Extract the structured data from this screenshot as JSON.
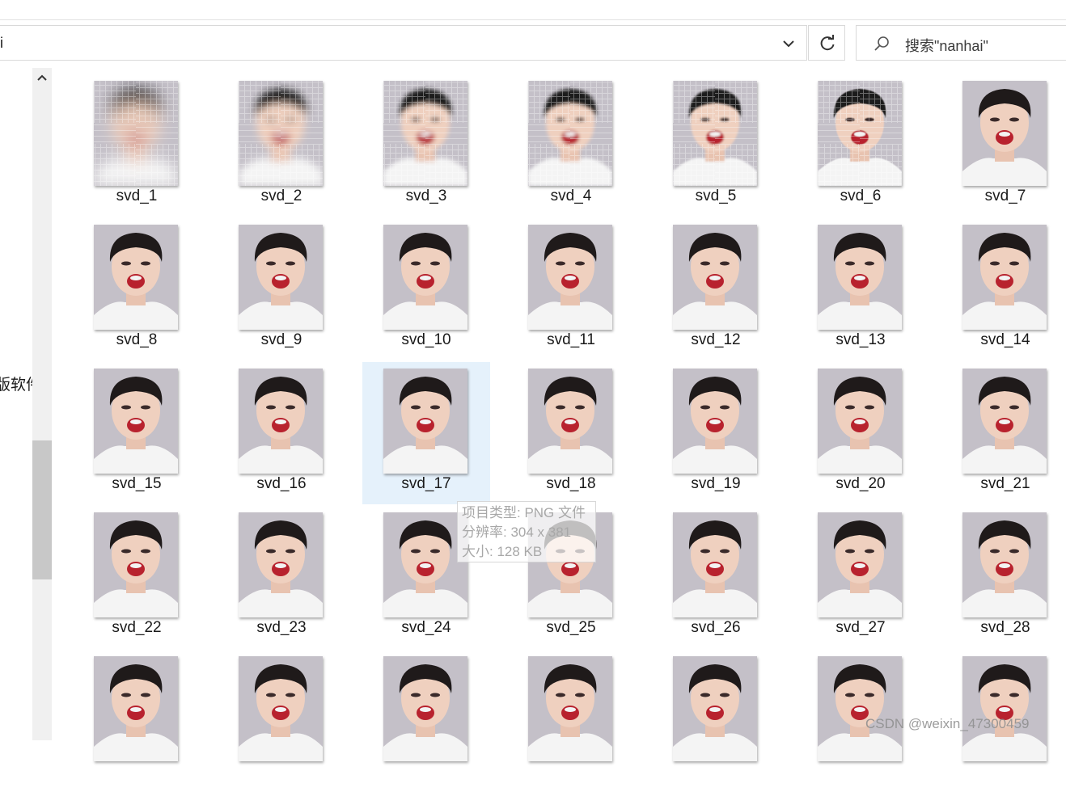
{
  "address_bar": {
    "path_fragment": "i"
  },
  "search": {
    "placeholder": "搜索\"nanhai\""
  },
  "nav_pane": {
    "partial_label": "版软件"
  },
  "files": [
    {
      "name": "svd_1"
    },
    {
      "name": "svd_2"
    },
    {
      "name": "svd_3"
    },
    {
      "name": "svd_4"
    },
    {
      "name": "svd_5"
    },
    {
      "name": "svd_6"
    },
    {
      "name": "svd_7"
    },
    {
      "name": "svd_8"
    },
    {
      "name": "svd_9"
    },
    {
      "name": "svd_10"
    },
    {
      "name": "svd_11"
    },
    {
      "name": "svd_12"
    },
    {
      "name": "svd_13"
    },
    {
      "name": "svd_14"
    },
    {
      "name": "svd_15"
    },
    {
      "name": "svd_16"
    },
    {
      "name": "svd_17",
      "selected": true
    },
    {
      "name": "svd_18"
    },
    {
      "name": "svd_19"
    },
    {
      "name": "svd_20"
    },
    {
      "name": "svd_21"
    },
    {
      "name": "svd_22"
    },
    {
      "name": "svd_23"
    },
    {
      "name": "svd_24"
    },
    {
      "name": "svd_25"
    },
    {
      "name": "svd_26"
    },
    {
      "name": "svd_27"
    },
    {
      "name": "svd_28"
    },
    {
      "name": ""
    },
    {
      "name": ""
    },
    {
      "name": ""
    },
    {
      "name": ""
    },
    {
      "name": ""
    },
    {
      "name": ""
    },
    {
      "name": ""
    }
  ],
  "tooltip": {
    "type_line": "项目类型: PNG 文件",
    "resolution_line": "分辨率: 304 x 381",
    "size_line": "大小: 128 KB"
  },
  "watermark": "CSDN @weixin_47300459"
}
